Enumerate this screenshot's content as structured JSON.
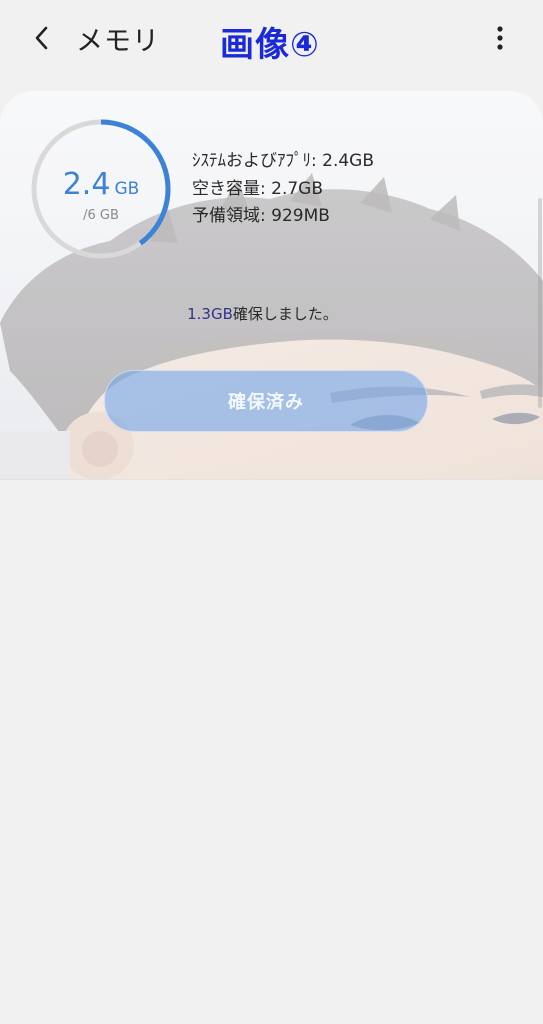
{
  "header": {
    "title": "メモリ",
    "overlay_caption": "画像④",
    "back_icon": "chevron-left-icon",
    "more_icon": "more-vertical-icon"
  },
  "memory": {
    "used_value": "2.4",
    "used_unit": "GB",
    "total_label": "/6 GB",
    "used_fraction": 0.4,
    "stats": [
      "ｼｽﾃﾑおよびｱﾌﾟﾘ: 2.4GB",
      "空き容量: 2.7GB",
      "予備領域: 929MB"
    ],
    "freed_amount": "1.3GB",
    "freed_suffix": "確保しました。",
    "button_label": "確保済み"
  },
  "colors": {
    "accent": "#3c82d6",
    "caption": "#1a2ad8",
    "ring_track": "#d9d9d9"
  }
}
